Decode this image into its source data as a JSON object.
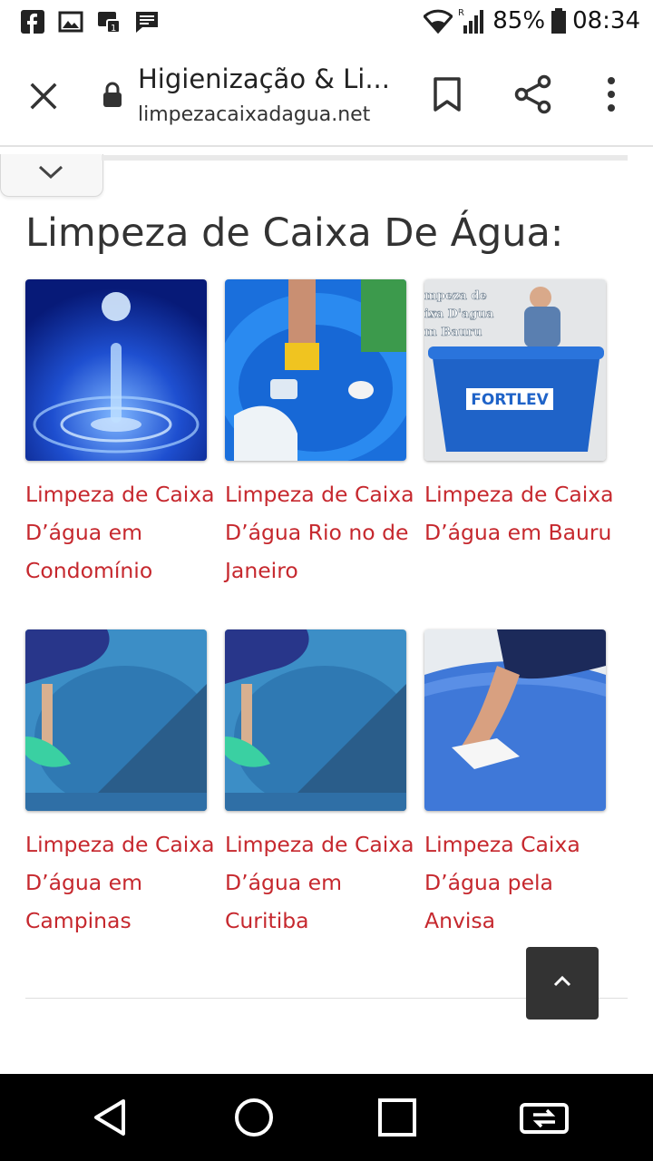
{
  "status_bar": {
    "battery": "85%",
    "time": "08:34",
    "icons": [
      "facebook-icon",
      "gallery-icon",
      "notification-icon",
      "message-icon",
      "wifi-icon",
      "signal-icon",
      "battery-icon"
    ]
  },
  "browser": {
    "page_title": "Higienização & Li...",
    "url": "limpezacaixadagua.net",
    "icons": [
      "close-icon",
      "lock-icon",
      "bookmark-icon",
      "share-icon",
      "more-icon"
    ]
  },
  "content": {
    "heading": "Limpeza de Caixa De Água:",
    "cards": [
      {
        "caption": "Limpeza de Caixa D’água em Condomínio"
      },
      {
        "caption": "Limpeza de Caixa D’água Rio no de Janeiro"
      },
      {
        "caption": "Limpeza de Caixa D’água em Bauru",
        "image_text": [
          "mpeza de",
          "ixa D'agua",
          "m Bauru"
        ],
        "brand": "FORTLEV"
      },
      {
        "caption": "Limpeza de Caixa D’água em Campinas"
      },
      {
        "caption": "Limpeza de Caixa D’água em Curitiba"
      },
      {
        "caption": "Limpeza Caixa D’água pela Anvisa"
      }
    ]
  },
  "colors": {
    "link": "#c6282e",
    "heading": "#333333",
    "water_blue": "#1f6fe0"
  }
}
